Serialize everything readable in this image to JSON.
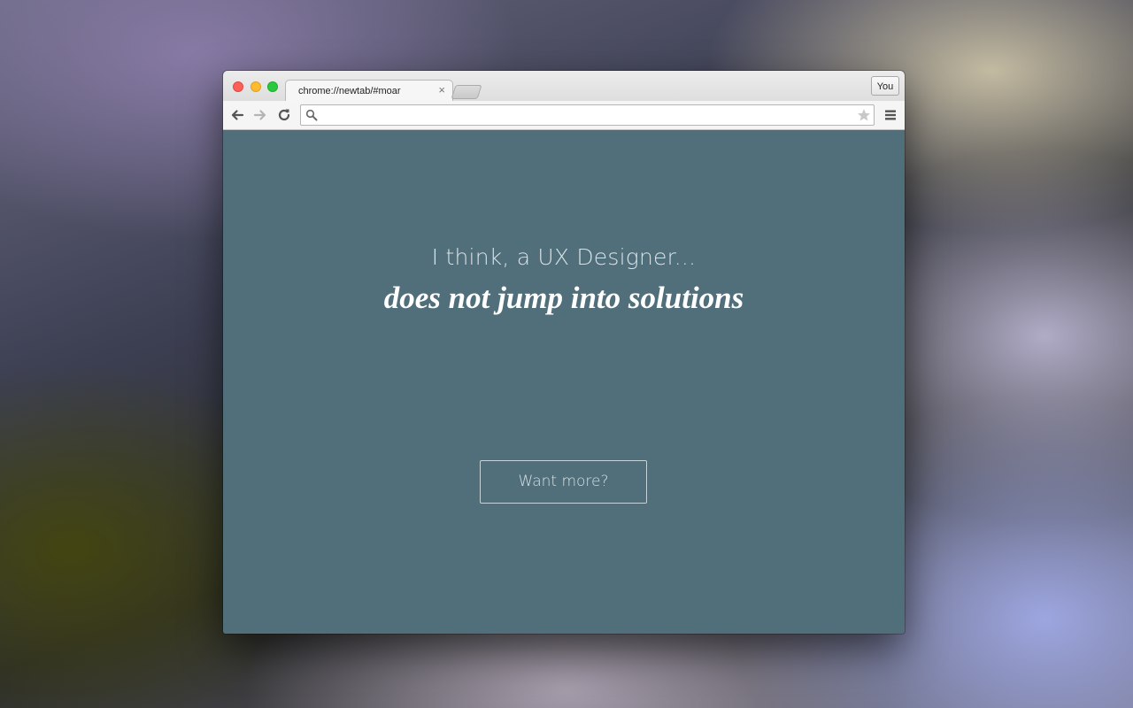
{
  "browser": {
    "tab": {
      "title": "chrome://newtab/#moar",
      "close_glyph": "×"
    },
    "profile_label": "You",
    "toolbar": {
      "back_icon": "arrow-left-icon",
      "forward_icon": "arrow-right-icon",
      "reload_icon": "reload-icon",
      "menu_icon": "hamburger-menu-icon",
      "bookmark_icon": "star-icon",
      "search_icon": "magnifier-icon"
    },
    "address_bar": {
      "value": "",
      "placeholder": ""
    }
  },
  "page": {
    "lead_text": "I think, a UX Designer...",
    "headline": "does not jump into solutions",
    "cta_label": "Want more?",
    "background_color": "#506f7b"
  },
  "colors": {
    "close": "#fc5f57",
    "minimize": "#fdbc2e",
    "maximize": "#29c940"
  }
}
